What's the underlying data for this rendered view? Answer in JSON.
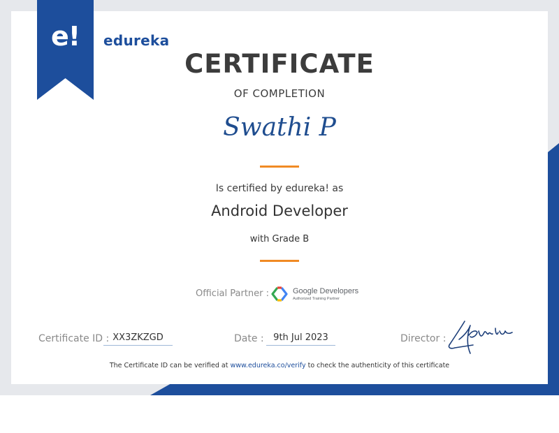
{
  "brand": {
    "logo_mark": "e!",
    "name": "edureka",
    "accent_color": "#1d4e9c"
  },
  "certificate": {
    "title": "CERTIFICATE",
    "subtitle": "OF COMPLETION",
    "recipient": "Swathi P",
    "certified_text": "Is certified by edureka! as",
    "course": "Android Developer",
    "grade_text": "with Grade B",
    "divider_color": "#f08a24"
  },
  "partner": {
    "label": "Official Partner :",
    "name": "Google Developers",
    "tagline": "Authorized Training Partner",
    "icon": "google-developers-icon"
  },
  "details": {
    "certificate_id_label": "Certificate ID :",
    "certificate_id": "XX3ZKZGD",
    "date_label": "Date :",
    "date": "9th Jul 2023",
    "director_label": "Director :"
  },
  "footer": {
    "verify_prefix": "The Certificate ID can be verified at ",
    "verify_link": "www.edureka.co/verify",
    "verify_suffix": " to check the authenticity of this certificate"
  }
}
